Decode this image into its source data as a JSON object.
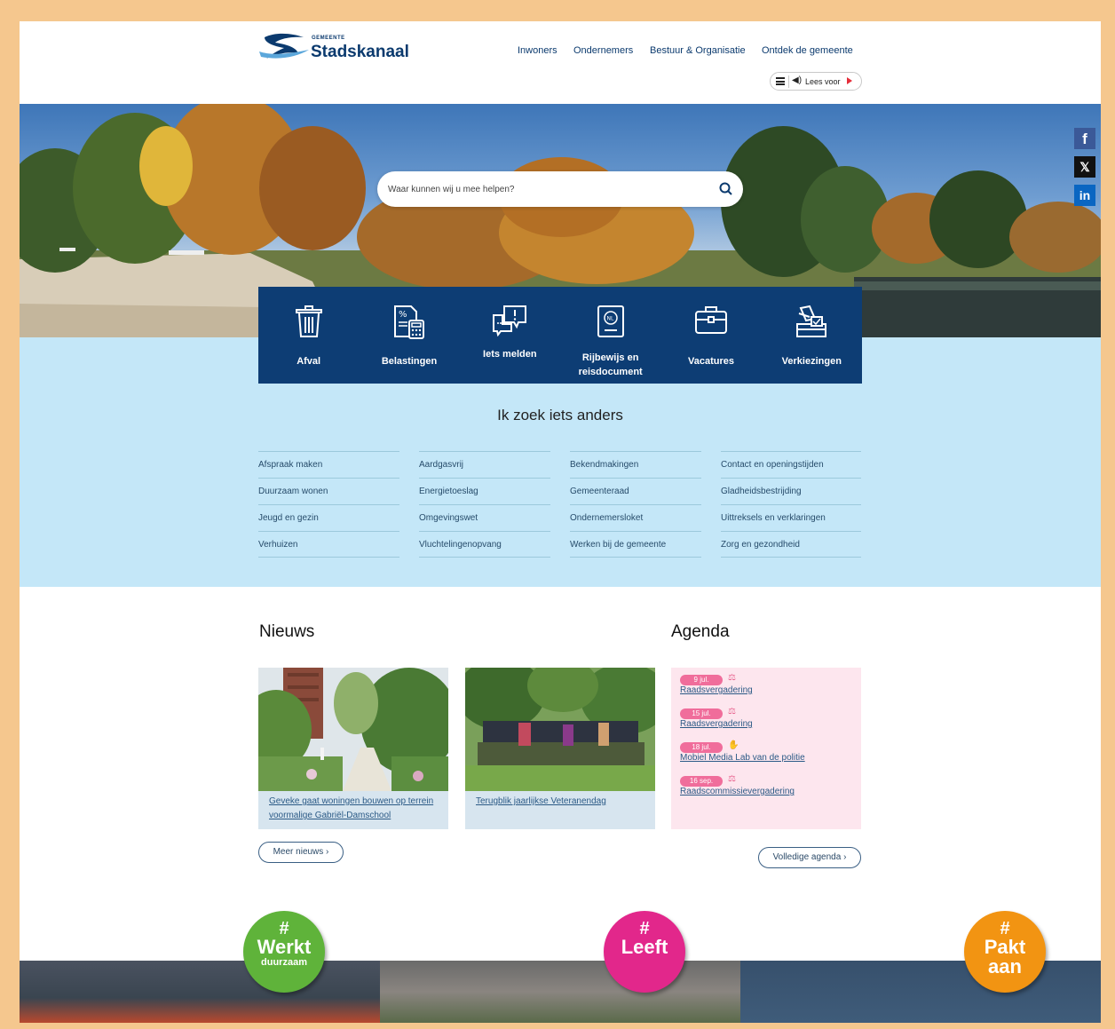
{
  "header": {
    "logo_small": "GEMEENTE",
    "logo_name": "Stadskanaal",
    "nav": [
      "Inwoners",
      "Ondernemers",
      "Bestuur & Organisatie",
      "Ontdek de gemeente"
    ],
    "readspeaker_label": "Lees voor"
  },
  "search": {
    "placeholder": "Waar kunnen wij u mee helpen?"
  },
  "social": [
    "f",
    "𝕏",
    "in"
  ],
  "tiles": [
    {
      "label": "Afval",
      "icon": "trash-icon"
    },
    {
      "label": "Belastingen",
      "icon": "tax-calculator-icon"
    },
    {
      "label": "Iets melden",
      "icon": "report-speech-icon"
    },
    {
      "label": "Rijbewijs en reisdocument",
      "line1": "Rijbewijs en",
      "line2": "reisdocument",
      "icon": "passport-icon"
    },
    {
      "label": "Vacatures",
      "icon": "briefcase-icon"
    },
    {
      "label": "Verkiezingen",
      "icon": "ballot-box-icon"
    }
  ],
  "zoek": {
    "title": "Ik zoek iets anders",
    "columns": [
      [
        "Afspraak maken",
        "Duurzaam wonen",
        "Jeugd en gezin",
        "Verhuizen"
      ],
      [
        "Aardgasvrij",
        "Energietoeslag",
        "Omgevingswet",
        "Vluchtelingenopvang"
      ],
      [
        "Bekendmakingen",
        "Gemeenteraad",
        "Ondernemersloket",
        "Werken bij de gemeente"
      ],
      [
        "Contact en openingstijden",
        "Gladheidsbestrijding",
        "Uittreksels en verklaringen",
        "Zorg en gezondheid"
      ]
    ]
  },
  "news": {
    "title": "Nieuws",
    "items": [
      {
        "title": "Geveke gaat woningen bouwen op terrein voormalige Gabriël-Damschool"
      },
      {
        "title": "Terugblik jaarlijkse Veteranendag"
      }
    ],
    "more_label": "Meer nieuws ›"
  },
  "agenda": {
    "title": "Agenda",
    "items": [
      {
        "date": "9 jul.",
        "title": "Raadsvergadering",
        "icon": "gavel-icon"
      },
      {
        "date": "15 jul.",
        "title": "Raadsvergadering",
        "icon": "gavel-icon"
      },
      {
        "date": "18 jul.",
        "title": "Mobiel Media Lab van de politie",
        "icon": "handshake-icon"
      },
      {
        "date": "16 sep.",
        "title": "Raadscommissievergadering",
        "icon": "gavel-icon"
      }
    ],
    "more_label": "Volledige agenda ›"
  },
  "badges": [
    {
      "hash": "#",
      "big": "Werkt",
      "small": "duurzaam",
      "color": "#5fb33a"
    },
    {
      "hash": "#",
      "big": "Leeft",
      "small": "",
      "color": "#e2278b"
    },
    {
      "hash": "#",
      "big": "Pakt",
      "small": "aan",
      "color": "#f29412"
    }
  ],
  "colors": {
    "primary": "#0d3d74",
    "light_blue": "#c4e7f8",
    "agenda_bg": "#fde6ee",
    "frame": "#f5c78e"
  }
}
